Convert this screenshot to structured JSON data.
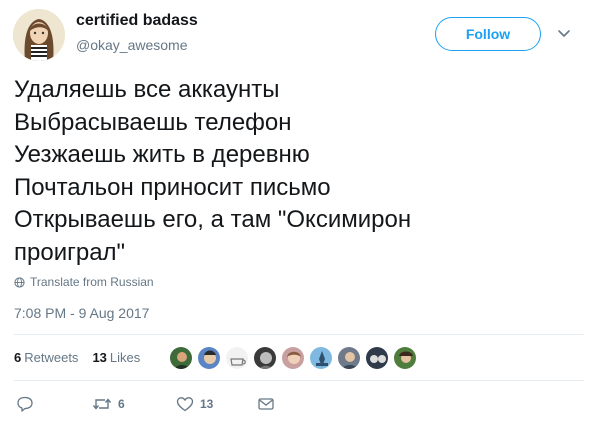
{
  "author": {
    "display_name": "certified badass",
    "handle": "@okay_awesome",
    "avatar_icon": "avatar-illustration"
  },
  "follow": {
    "label": "Follow"
  },
  "tweet": {
    "lines": [
      "Удаляешь все аккаунты",
      "Выбрасываешь телефон",
      "Уезжаешь жить в деревню",
      "Почтальон приносит письмо",
      "Открываешь его, а там \"Оксимирон",
      "проиграл\""
    ]
  },
  "translate": {
    "label": "Translate from Russian",
    "icon": "globe-icon"
  },
  "timestamp": "7:08 PM - 9 Aug 2017",
  "stats": {
    "retweets_count": "6",
    "retweets_label": "Retweets",
    "likes_count": "13",
    "likes_label": "Likes"
  },
  "liker_avatars": [
    {
      "name": "liker-avatar-1",
      "color": "#3d6b3a"
    },
    {
      "name": "liker-avatar-2",
      "color": "#5a84c4"
    },
    {
      "name": "liker-avatar-3",
      "color": "#f2f2f2"
    },
    {
      "name": "liker-avatar-4",
      "color": "#3a3a3a"
    },
    {
      "name": "liker-avatar-5",
      "color": "#c9a0a0"
    },
    {
      "name": "liker-avatar-6",
      "color": "#7fb8e0"
    },
    {
      "name": "liker-avatar-7",
      "color": "#6e7a8a"
    },
    {
      "name": "liker-avatar-8",
      "color": "#2f3b4a"
    },
    {
      "name": "liker-avatar-9",
      "color": "#4f7d3e"
    }
  ],
  "actions": {
    "reply_icon": "reply-icon",
    "retweet_icon": "retweet-icon",
    "retweet_count": "6",
    "like_icon": "heart-icon",
    "like_count": "13",
    "dm_icon": "envelope-icon"
  },
  "colors": {
    "accent": "#1da1f2",
    "text": "#14171a",
    "secondary": "#657786",
    "divider": "#e6ecf0"
  }
}
